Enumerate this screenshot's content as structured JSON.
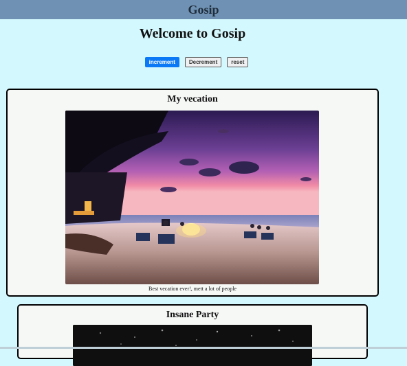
{
  "navbar": {
    "brand": "Gosip"
  },
  "page": {
    "title": "Welcome to Gosip"
  },
  "buttons": {
    "increment": "increment",
    "decrement": "Decrement",
    "reset": "reset"
  },
  "posts": [
    {
      "title": "My vecation",
      "caption": "Best vecation ever!, mett a lot of people",
      "image": "beach-sunset-photo"
    },
    {
      "title": "Insane Party",
      "image": "party-photo"
    }
  ],
  "colors": {
    "navbar": "#6f92b4",
    "background": "#d3f8fe",
    "primary_button": "#0b79f5",
    "card": "#f6f8f6"
  }
}
